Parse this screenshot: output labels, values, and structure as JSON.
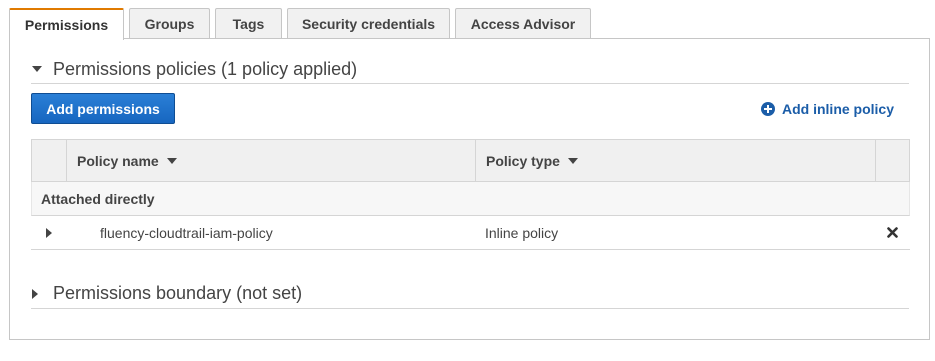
{
  "tabs": [
    {
      "label": "Permissions",
      "active": true
    },
    {
      "label": "Groups",
      "active": false
    },
    {
      "label": "Tags",
      "active": false
    },
    {
      "label": "Security credentials",
      "active": false
    },
    {
      "label": "Access Advisor",
      "active": false
    }
  ],
  "permissions_policies": {
    "title": "Permissions policies (1 policy applied)",
    "expanded": true,
    "add_permissions_label": "Add permissions",
    "add_inline_policy_label": "Add inline policy",
    "table": {
      "columns": [
        "Policy name",
        "Policy type"
      ],
      "group_label": "Attached directly",
      "rows": [
        {
          "policy_name": "fluency-cloudtrail-iam-policy",
          "policy_type": "Inline policy"
        }
      ]
    }
  },
  "permissions_boundary": {
    "title": "Permissions boundary (not set)",
    "expanded": false
  },
  "colors": {
    "accent_tab": "#e07a00",
    "primary_button": "#1766c0",
    "link": "#1b5da8"
  },
  "icons": [
    "caret-down-icon",
    "plus-circle-icon",
    "sort-down-icon",
    "caret-right-icon",
    "remove-icon"
  ]
}
